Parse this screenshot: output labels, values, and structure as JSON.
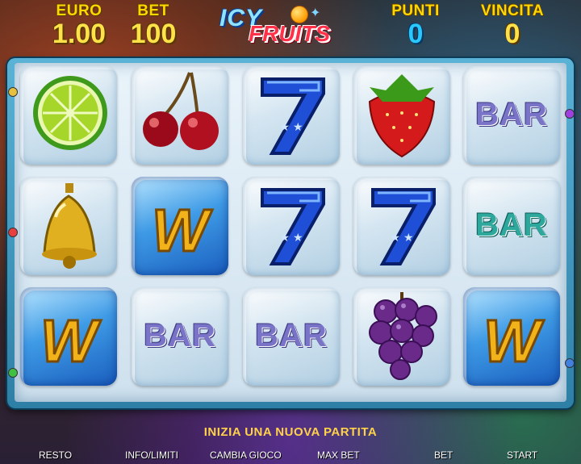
{
  "header": {
    "euro_label": "EURO",
    "euro_value": "1.00",
    "bet_label": "BET",
    "bet_value": "100",
    "punti_label": "PUNTI",
    "punti_value": "0",
    "vincita_label": "VINCITA",
    "vincita_value": "0"
  },
  "logo": {
    "line1": "ICY",
    "line2": "FRUITS"
  },
  "reels": {
    "rows": [
      [
        "lime",
        "cherries",
        "seven",
        "strawberry",
        "bar"
      ],
      [
        "bell",
        "wild",
        "seven",
        "seven",
        "bar"
      ],
      [
        "wild",
        "bar",
        "bar",
        "grapes",
        "wild"
      ]
    ],
    "bar_text": "BAR",
    "wild_text": "W"
  },
  "message": "INIZIA UNA NUOVA PARTITA",
  "buttons": {
    "resto": "RESTO",
    "info": "INFO/LIMITI",
    "cambia": "CAMBIA GIOCO",
    "maxbet": "MAX BET",
    "bet": "BET",
    "start": "START"
  },
  "colors": {
    "label_gold": "#ffd700",
    "value_blue": "#29c9ff",
    "frame": "#2e7fa6"
  }
}
